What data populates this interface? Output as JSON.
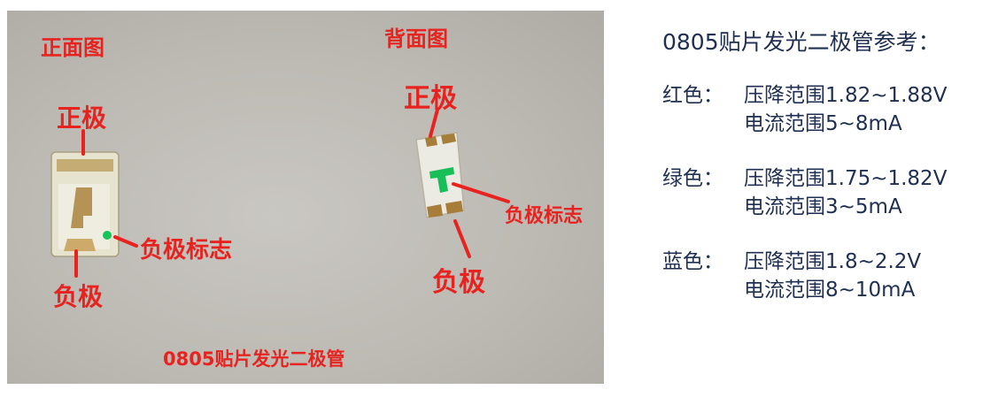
{
  "photo": {
    "front_title": "正面图",
    "back_title": "背面图",
    "front_labels": {
      "positive": "正极",
      "negative": "负极",
      "negative_mark": "负极标志"
    },
    "back_labels": {
      "positive": "正极",
      "negative": "负极",
      "negative_mark": "负极标志"
    },
    "caption": "0805贴片发光二极管"
  },
  "info": {
    "title": "0805贴片发光二极管参考：",
    "specs": [
      {
        "color": "红色：",
        "voltage": "压降范围1.82~1.88V",
        "current": "电流范围5~8mA"
      },
      {
        "color": "绿色：",
        "voltage": "压降范围1.75~1.82V",
        "current": "电流范围3~5mA"
      },
      {
        "color": "蓝色：",
        "voltage": "压降范围1.8~2.2V",
        "current": "电流范围8~10mA"
      }
    ]
  },
  "colors": {
    "label_red": "#e8231f",
    "info_text": "#1f2f52",
    "marker_green": "#16c45a"
  }
}
